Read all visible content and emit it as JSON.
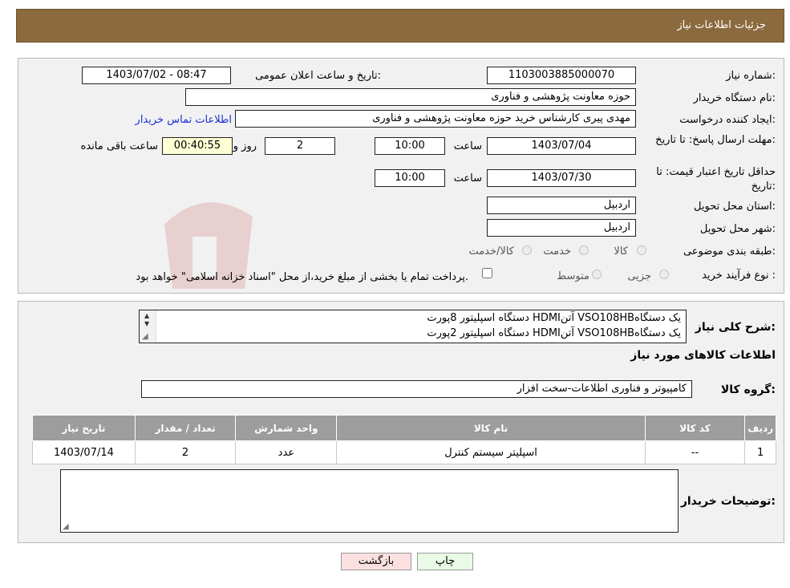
{
  "header": {
    "title": "جزئیات اطلاعات نیاز"
  },
  "form": {
    "need_number_label": "شماره نیاز:",
    "need_number": "1103003885000070",
    "announce_label": "تاریخ و ساعت اعلان عمومی:",
    "announce_value": "1403/07/02 - 08:47",
    "buyer_org_label": "نام دستگاه خریدار:",
    "buyer_org": "حوزه معاونت پژوهشی و فناوری",
    "creator_label": "ایجاد کننده درخواست:",
    "creator": "مهدی پیری کارشناس خرید حوزه معاونت پژوهشی و فناوری",
    "contact_link": "اطلاعات تماس خریدار",
    "deadline_label": "مهلت ارسال پاسخ: تا تاریخ:",
    "deadline_date": "1403/07/04",
    "time_label": "ساعت",
    "deadline_time": "10:00",
    "days_value": "2",
    "days_label": "روز و",
    "remaining_time": "00:40:55",
    "remaining_label": "ساعت باقی مانده",
    "validity_label": "حداقل تاریخ اعتبار قیمت: تا تاریخ:",
    "validity_date": "1403/07/30",
    "validity_time": "10:00",
    "province_label": "استان محل تحویل:",
    "province": "اردبیل",
    "city_label": "شهر محل تحویل:",
    "city": "اردبیل",
    "category_label": "طبقه بندی موضوعی:",
    "category_options": [
      "کالا",
      "خدمت",
      "کالا/خدمت"
    ],
    "purchase_type_label": "نوع فرآیند خرید :",
    "purchase_options": [
      "جزیی",
      "متوسط"
    ],
    "purchase_note": "پرداخت تمام یا بخشی از مبلغ خرید،از محل \"اسناد خزانه اسلامی\" خواهد بود."
  },
  "details": {
    "summary_label": "شرح کلی نیاز:",
    "summary_lines": [
      "دستگاه اسپلیتور 8پورت HDMIآتن VSO108HBیک دستگاه",
      "دستگاه اسپلیتور 2پورت HDMIآتن VSO108HBیک دستگاه"
    ],
    "goods_info_title": "اطلاعات کالاهای مورد نیاز",
    "goods_group_label": "گروه کالا:",
    "goods_group": "کامپیوتر و فناوری اطلاعات-سخت افزار",
    "table": {
      "headers": [
        "ردیف",
        "کد کالا",
        "نام کالا",
        "واحد شمارش",
        "تعداد / مقدار",
        "تاریخ نیاز"
      ],
      "rows": [
        [
          "1",
          "--",
          "اسپلیتر سیستم کنترل",
          "عدد",
          "2",
          "1403/07/14"
        ]
      ]
    },
    "buyer_notes_label": "توضیحات خریدار:",
    "buyer_notes": ""
  },
  "buttons": {
    "print": "چاپ",
    "back": "بازگشت"
  },
  "colors": {
    "header_bg": "#8b6a3d",
    "link": "#1a2fd6",
    "back_button_bg": "#fbe0e0",
    "print_button_bg": "#e9fbe6"
  }
}
